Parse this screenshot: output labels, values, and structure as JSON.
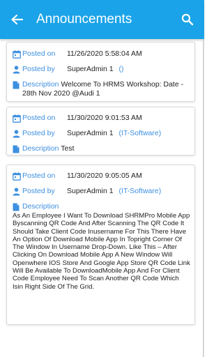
{
  "header": {
    "title": "Announcements"
  },
  "labels": {
    "posted_on": "Posted on",
    "posted_by": "Posted by",
    "description": "Description"
  },
  "announcements": [
    {
      "posted_on": "11/26/2020 5:58:04 AM",
      "posted_by": "SuperAdmin 1",
      "department": "()",
      "description": "Welcome To HRMS Workshop: Date - 28th Nov 2020 @Audi 1"
    },
    {
      "posted_on": "11/30/2020 9:01:53 AM",
      "posted_by": "SuperAdmin 1",
      "department": "(IT-Software)",
      "description": "Test"
    },
    {
      "posted_on": "11/30/2020 9:05:05 AM",
      "posted_by": "SuperAdmin 1",
      "department": "(IT-Software)",
      "description": "As An Employee I Want To Download SHRMPro Mobile App Byscanning QR Code And After Scanning The QR Code It Should Take Client Code Inusername For This There Have An Option Of Download Mobile App In Topright Corner Of The Window In Username Drop-Down. Like This – After Clicking On Download Mobile App A New Window Will Openwhere IOS Store And Google App Store QR Code Link Will Be Available To DownloadMobile App And For Client Code Employee Need To Scan Another QR Code Which Isin Right Side Of The Grid."
    }
  ],
  "icons": {
    "back": "arrow-left-icon",
    "search": "search-icon",
    "calendar": "calendar-icon",
    "person": "person-icon",
    "document": "document-icon"
  },
  "colors": {
    "appbar": "#1aa3e8",
    "label": "#3d8fe0",
    "icon": "#3d8fe0"
  }
}
